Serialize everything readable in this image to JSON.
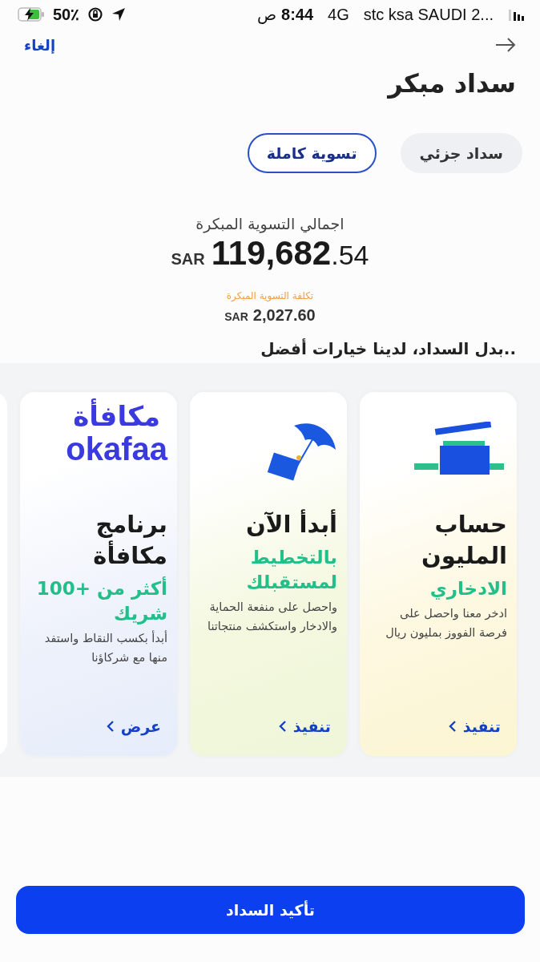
{
  "status_bar": {
    "battery": "50٪",
    "time": "8:44",
    "period": "ص",
    "network": "4G",
    "carrier": "stc ksa SAUDI 2..."
  },
  "header": {
    "cancel": "إلغاء",
    "title": "سداد مبكر"
  },
  "tabs": [
    {
      "label": "سداد جزئي",
      "selected": false
    },
    {
      "label": "تسوية كاملة",
      "selected": true
    }
  ],
  "summary": {
    "label": "اجمالي التسوية المبكرة",
    "currency": "SAR",
    "amount_main": "119,682",
    "amount_decimals": ".54",
    "fee_label": "تكلفة التسوية المبكرة",
    "fee_currency": "SAR",
    "fee_amount": "2,027.60"
  },
  "offers_heading": "..بدل السداد، لدينا خيارات أفضل",
  "cards": [
    {
      "kind": "gift",
      "title": "حساب المليون",
      "subtitle": "الادخاري",
      "description": "ادخر معنا واحصل على فرصة الفووز بمليون ريال",
      "action": "تنفيذ"
    },
    {
      "kind": "umbrella",
      "title": "أبدأ الآن",
      "subtitle": "بالتخطيط لمستقبلك",
      "description": "واحصل على منفعة الحماية والادخار واستكشف منتجاتنا",
      "action": "تنفيذ"
    },
    {
      "kind": "logo",
      "logo_lines": [
        "مكافأة",
        "okafaa"
      ],
      "title": "برنامج مكافأة",
      "subtitle": "أكثر من +100 شريك",
      "description": "أبدأ بكسب النقاط واستفد منها مع شركاؤنا",
      "action": "عرض"
    }
  ],
  "confirm_button": "تأكيد السداد"
}
